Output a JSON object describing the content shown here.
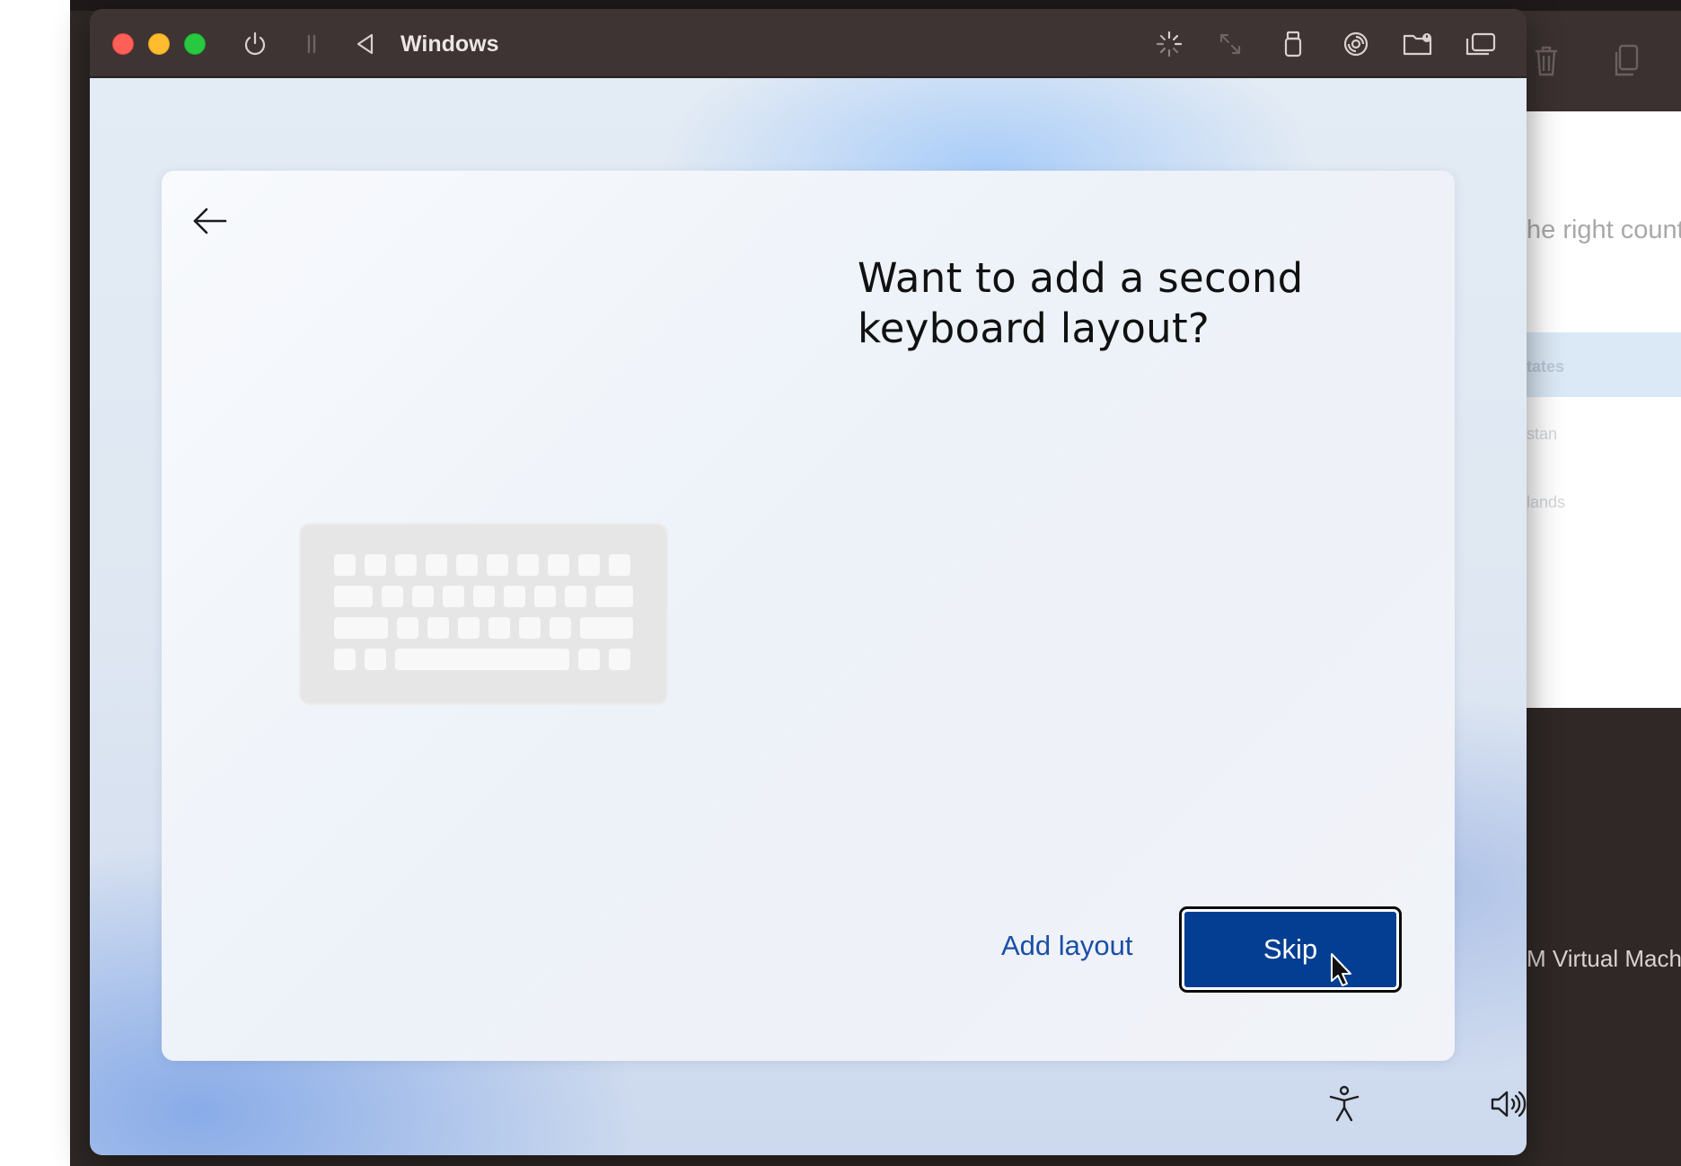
{
  "background_app": {
    "heading_fragment": "he right count",
    "list_items": [
      "tates",
      "stan",
      "lands"
    ],
    "vm_label_fragment": "M Virtual Mach",
    "toolbar_icons": [
      "trash-icon",
      "copy-icon"
    ]
  },
  "vm_window": {
    "title": "Windows",
    "title_icons": [
      "power-icon",
      "pause-icon",
      "back-triangle-icon"
    ],
    "toolbar_icons": [
      "loading-icon",
      "resize-icon",
      "usb-icon",
      "disc-icon",
      "shared-folder-icon",
      "display-icon"
    ]
  },
  "oobe": {
    "headline": "Want to add a second keyboard layout?",
    "illustration": "keyboard-illustration",
    "add_layout_label": "Add layout",
    "skip_label": "Skip",
    "bottom_icons": [
      "accessibility-icon",
      "volume-icon"
    ]
  },
  "colors": {
    "titlebar": "#3e3433",
    "primary_button": "#043e93",
    "link": "#1a4fa8",
    "close": "#fe5f57",
    "minimize": "#febc2e",
    "maximize": "#28c840"
  }
}
